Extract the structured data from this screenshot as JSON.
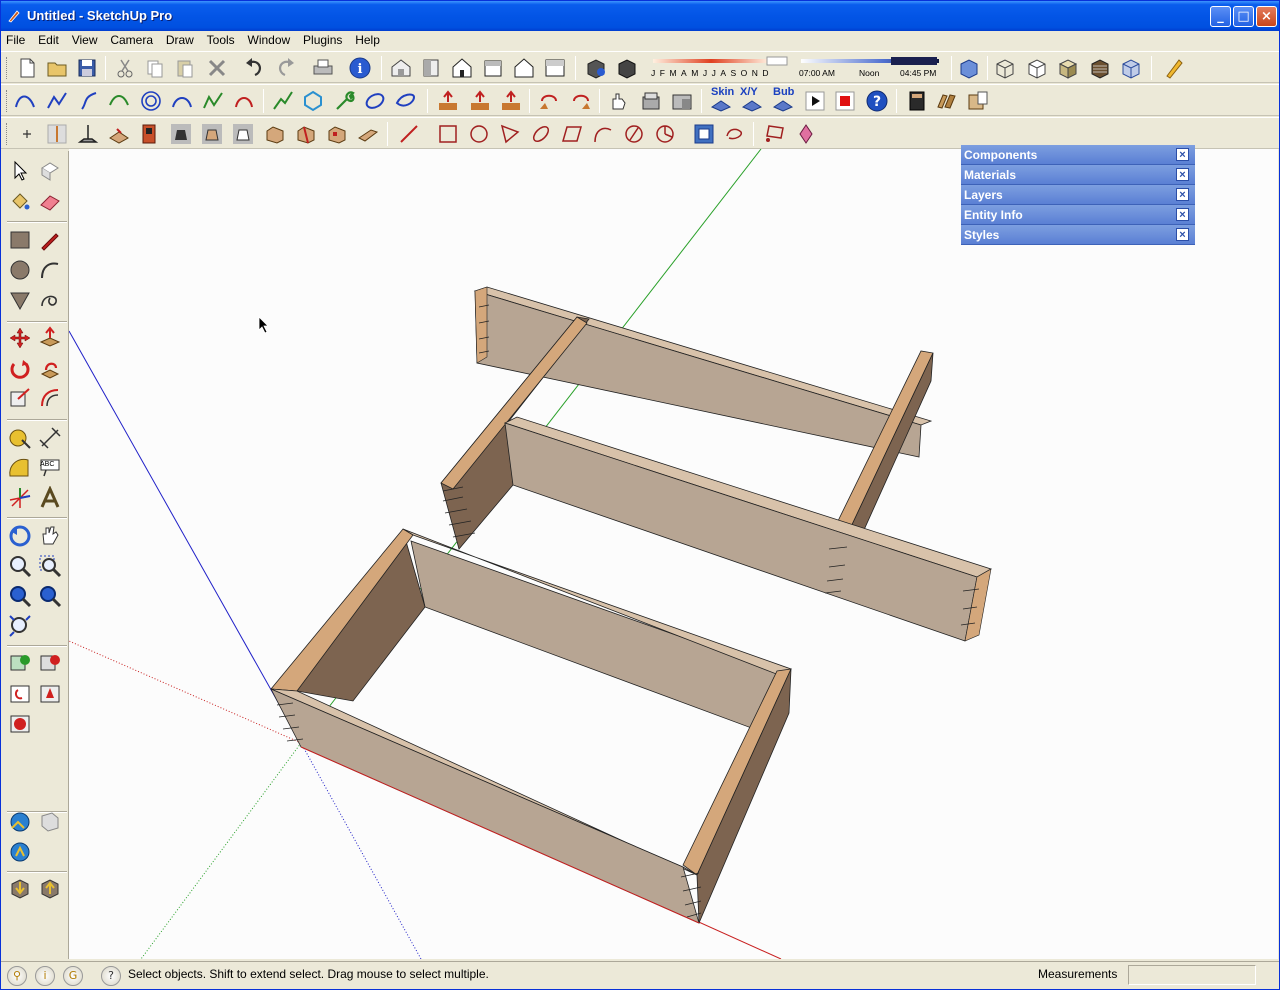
{
  "window": {
    "title": "Untitled - SketchUp Pro",
    "minimize": "_",
    "maximize": "□",
    "close": "×"
  },
  "menu": [
    "File",
    "Edit",
    "View",
    "Camera",
    "Draw",
    "Tools",
    "Window",
    "Plugins",
    "Help"
  ],
  "shadow_timeline": {
    "months": [
      "J",
      "F",
      "M",
      "A",
      "M",
      "J",
      "J",
      "A",
      "S",
      "O",
      "N",
      "D"
    ],
    "time_start": "07:00 AM",
    "time_mid": "Noon",
    "time_end": "04:45 PM"
  },
  "plugin_labels": {
    "skin": "Skin",
    "xy": "X/Y",
    "bub": "Bub"
  },
  "tray_panels": [
    "Components",
    "Materials",
    "Layers",
    "Entity Info",
    "Styles"
  ],
  "left_toolbar": {
    "text_icon": "ABC"
  },
  "status": {
    "message": "Select objects. Shift to extend select. Drag mouse to select multiple.",
    "measurements_label": "Measurements",
    "measurements_value": ""
  },
  "colors": {
    "title_bar": "#0355e6",
    "wood_face": "#b7a593",
    "wood_end": "#d4a77b",
    "wood_inner": "#7d6450",
    "viewport_bg": "#fcfcfc",
    "panel_header": "#6b8fd9"
  }
}
